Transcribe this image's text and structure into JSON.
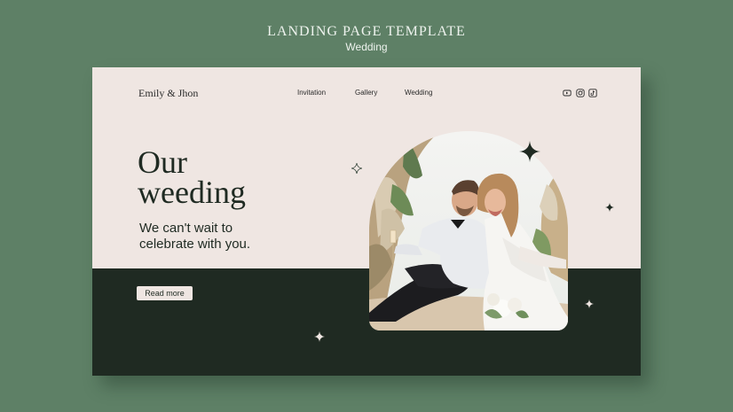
{
  "header": {
    "title": "LANDING PAGE TEMPLATE",
    "subtitle": "Wedding"
  },
  "card": {
    "brand": "Emily & Jhon",
    "nav": {
      "invitation": "Invitation",
      "gallery": "Gallery",
      "wedding": "Wedding"
    },
    "social_icons": [
      "youtube-icon",
      "instagram-icon",
      "tiktok-icon"
    ],
    "headline_line1": "Our",
    "headline_line2": "weeding",
    "subline_line1": "We can't wait to",
    "subline_line2": "celebrate with you.",
    "cta": "Read more",
    "colors": {
      "page_bg": "#5e8066",
      "card_top": "#efe6e2",
      "card_bottom": "#1f2a22"
    }
  }
}
